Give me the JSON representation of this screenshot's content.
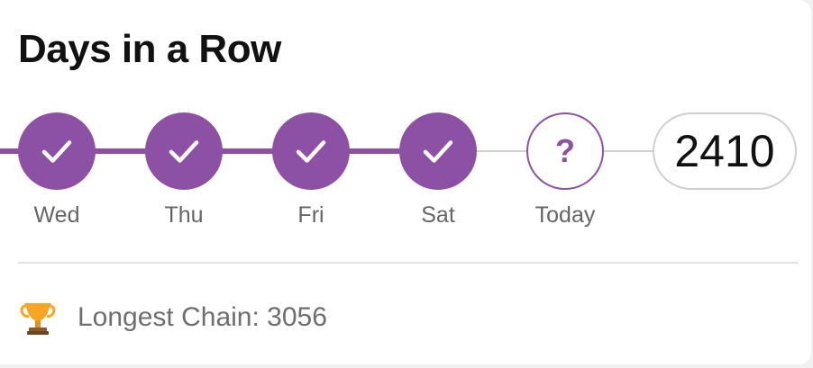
{
  "title": "Days in a Row",
  "days": [
    {
      "label": "Wed",
      "state": "done"
    },
    {
      "label": "Thu",
      "state": "done"
    },
    {
      "label": "Fri",
      "state": "done"
    },
    {
      "label": "Sat",
      "state": "done"
    },
    {
      "label": "Today",
      "state": "pending",
      "symbol": "?"
    }
  ],
  "current_streak": "2410",
  "longest_chain": {
    "icon": "trophy-icon",
    "text": "Longest Chain: 3056"
  },
  "colors": {
    "accent": "#8c51a5",
    "track_inactive": "#cfcfcf",
    "label_text": "#666666"
  }
}
